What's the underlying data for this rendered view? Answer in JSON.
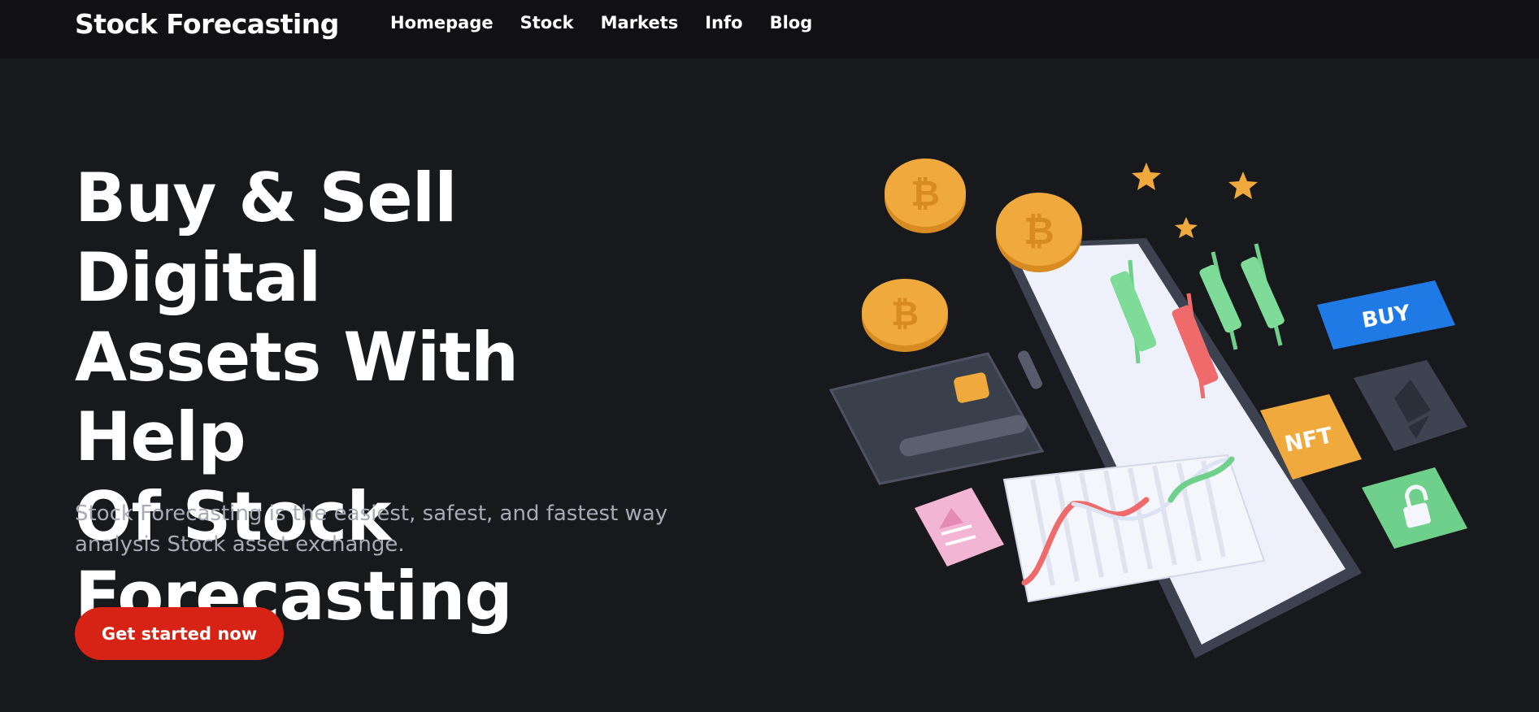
{
  "header": {
    "brand": "Stock Forecasting",
    "nav": [
      "Homepage",
      "Stock",
      "Markets",
      "Info",
      "Blog"
    ]
  },
  "hero": {
    "title_lines": [
      "Buy & Sell Digital",
      "Assets With Help",
      "Of Stock",
      "Forecasting"
    ],
    "subtitle_lines": [
      "Stock Forecasting is the easiest, safest, and fastest way",
      "analysis Stock asset exchange."
    ],
    "cta_label": "Get started now"
  },
  "illustration": {
    "buy_label": "BUY",
    "nft_label": "NFT",
    "coin_symbol": "₿"
  },
  "colors": {
    "background": "#18191d",
    "header": "#111113",
    "cta": "#d62315",
    "coin": "#f0a93c",
    "candle_green": "#6fd08c",
    "candle_red": "#ef6a6a",
    "buy_blue": "#1f7ae6"
  }
}
